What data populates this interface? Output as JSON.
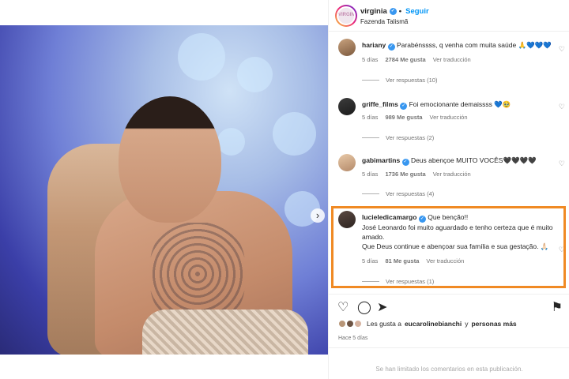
{
  "header": {
    "username": "virginia",
    "follow_label": "Seguir",
    "location": "Fazenda Talismã",
    "avatar_text": "VIRGINIA",
    "more": "•••"
  },
  "comments": [
    {
      "username": "hariany",
      "lines": [
        "Parabénssss, q venha com muita saúde 🙏💙💙💙"
      ],
      "time": "5 días",
      "likes": "2784 Me gusta",
      "translate": "Ver traducción",
      "replies": "Ver respuestas (10)",
      "verified": true
    },
    {
      "username": "griffe_films",
      "lines": [
        "Foi emocionante demaissss 💙🥹"
      ],
      "time": "5 días",
      "likes": "989 Me gusta",
      "translate": "Ver traducción",
      "replies": "Ver respuestas (2)",
      "verified": true
    },
    {
      "username": "gabimartins",
      "lines": [
        "Deus abençoe MUITO VOCÊS🖤🖤🖤🖤"
      ],
      "time": "5 días",
      "likes": "1736 Me gusta",
      "translate": "Ver traducción",
      "replies": "Ver respuestas (4)",
      "verified": true
    },
    {
      "username": "lucieledicamargo",
      "lines": [
        "Que benção!!",
        "José Leonardo foi muito aguardado e tenho certeza que é muito amado.",
        "Que Deus continue e abençoar sua família e sua gestação. 🙏🏻"
      ],
      "time": "5 días",
      "likes": "81 Me gusta",
      "translate": "Ver traducción",
      "replies": "Ver respuestas (1)",
      "verified": true
    }
  ],
  "actions": {
    "like_icon": "heart-icon",
    "comment_icon": "comment-icon",
    "share_icon": "send-icon",
    "save_icon": "bookmark-icon"
  },
  "likes": {
    "prefix": "Les gusta a",
    "user": "eucarolinebianchi",
    "connector": "y",
    "others": "personas más"
  },
  "time_ago": "Hace 5 días",
  "limited_comments": "Se han limitado los comentarios en esta publicación.",
  "colors": {
    "highlight": "#f08a24",
    "link": "#0095f6",
    "verified": "#3897f0"
  }
}
